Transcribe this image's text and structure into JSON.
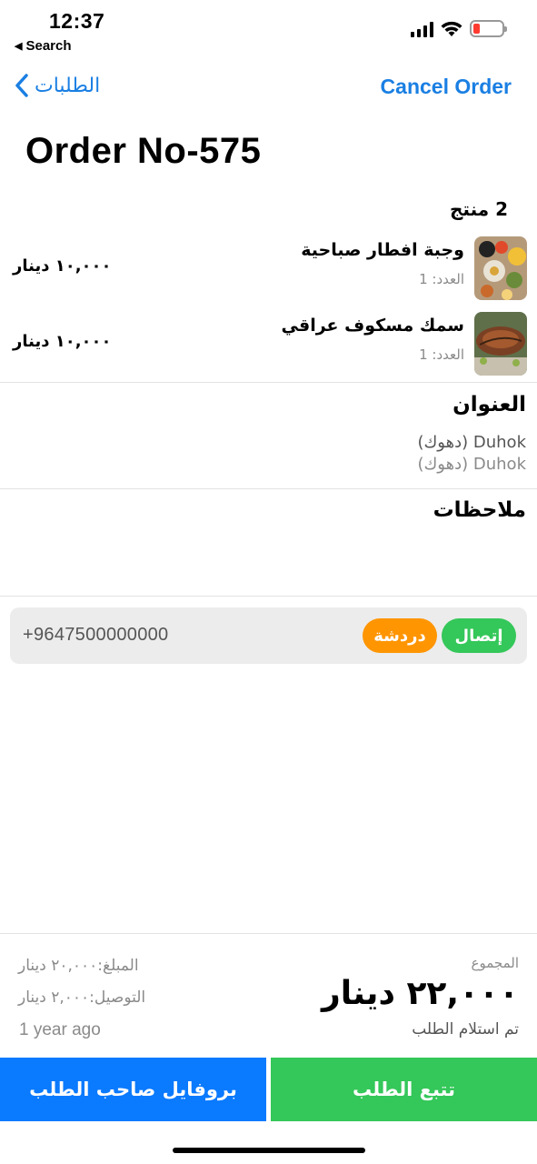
{
  "status_bar": {
    "time": "12:37",
    "back_label": "Search"
  },
  "nav": {
    "back_label": "الطلبات",
    "cancel_label": "Cancel Order"
  },
  "order": {
    "title": "Order No-575"
  },
  "products": {
    "count_label": "2 منتج",
    "items": [
      {
        "name": "وجبة افطار صباحية",
        "qty": "العدد: 1",
        "price": "١٠,٠٠٠ دينار"
      },
      {
        "name": "سمك مسكوف عراقي",
        "qty": "العدد: 1",
        "price": "١٠,٠٠٠ دينار"
      }
    ]
  },
  "address": {
    "title": "العنوان",
    "line1": "Duhok (دهوك)",
    "line2": "Duhok (دهوك)"
  },
  "notes": {
    "title": "ملاحظات"
  },
  "contact": {
    "phone": "+9647500000000",
    "chat_label": "دردشة",
    "call_label": "إتصال"
  },
  "summary": {
    "total_label": "المجموع",
    "total_value": "٢٢,٠٠٠ دينار",
    "status": "تم استلام الطلب",
    "amount": "المبلغ:٢٠,٠٠٠ دينار",
    "delivery": "التوصيل:٢,٠٠٠ دينار",
    "time_ago": "1 year ago"
  },
  "actions": {
    "track_label": "تتبع الطلب",
    "profile_label": "بروفايل صاحب الطلب"
  },
  "colors": {
    "accent_blue": "#1a7fe3",
    "green": "#34c759",
    "orange": "#ff9500",
    "button_blue": "#0a7aff"
  }
}
